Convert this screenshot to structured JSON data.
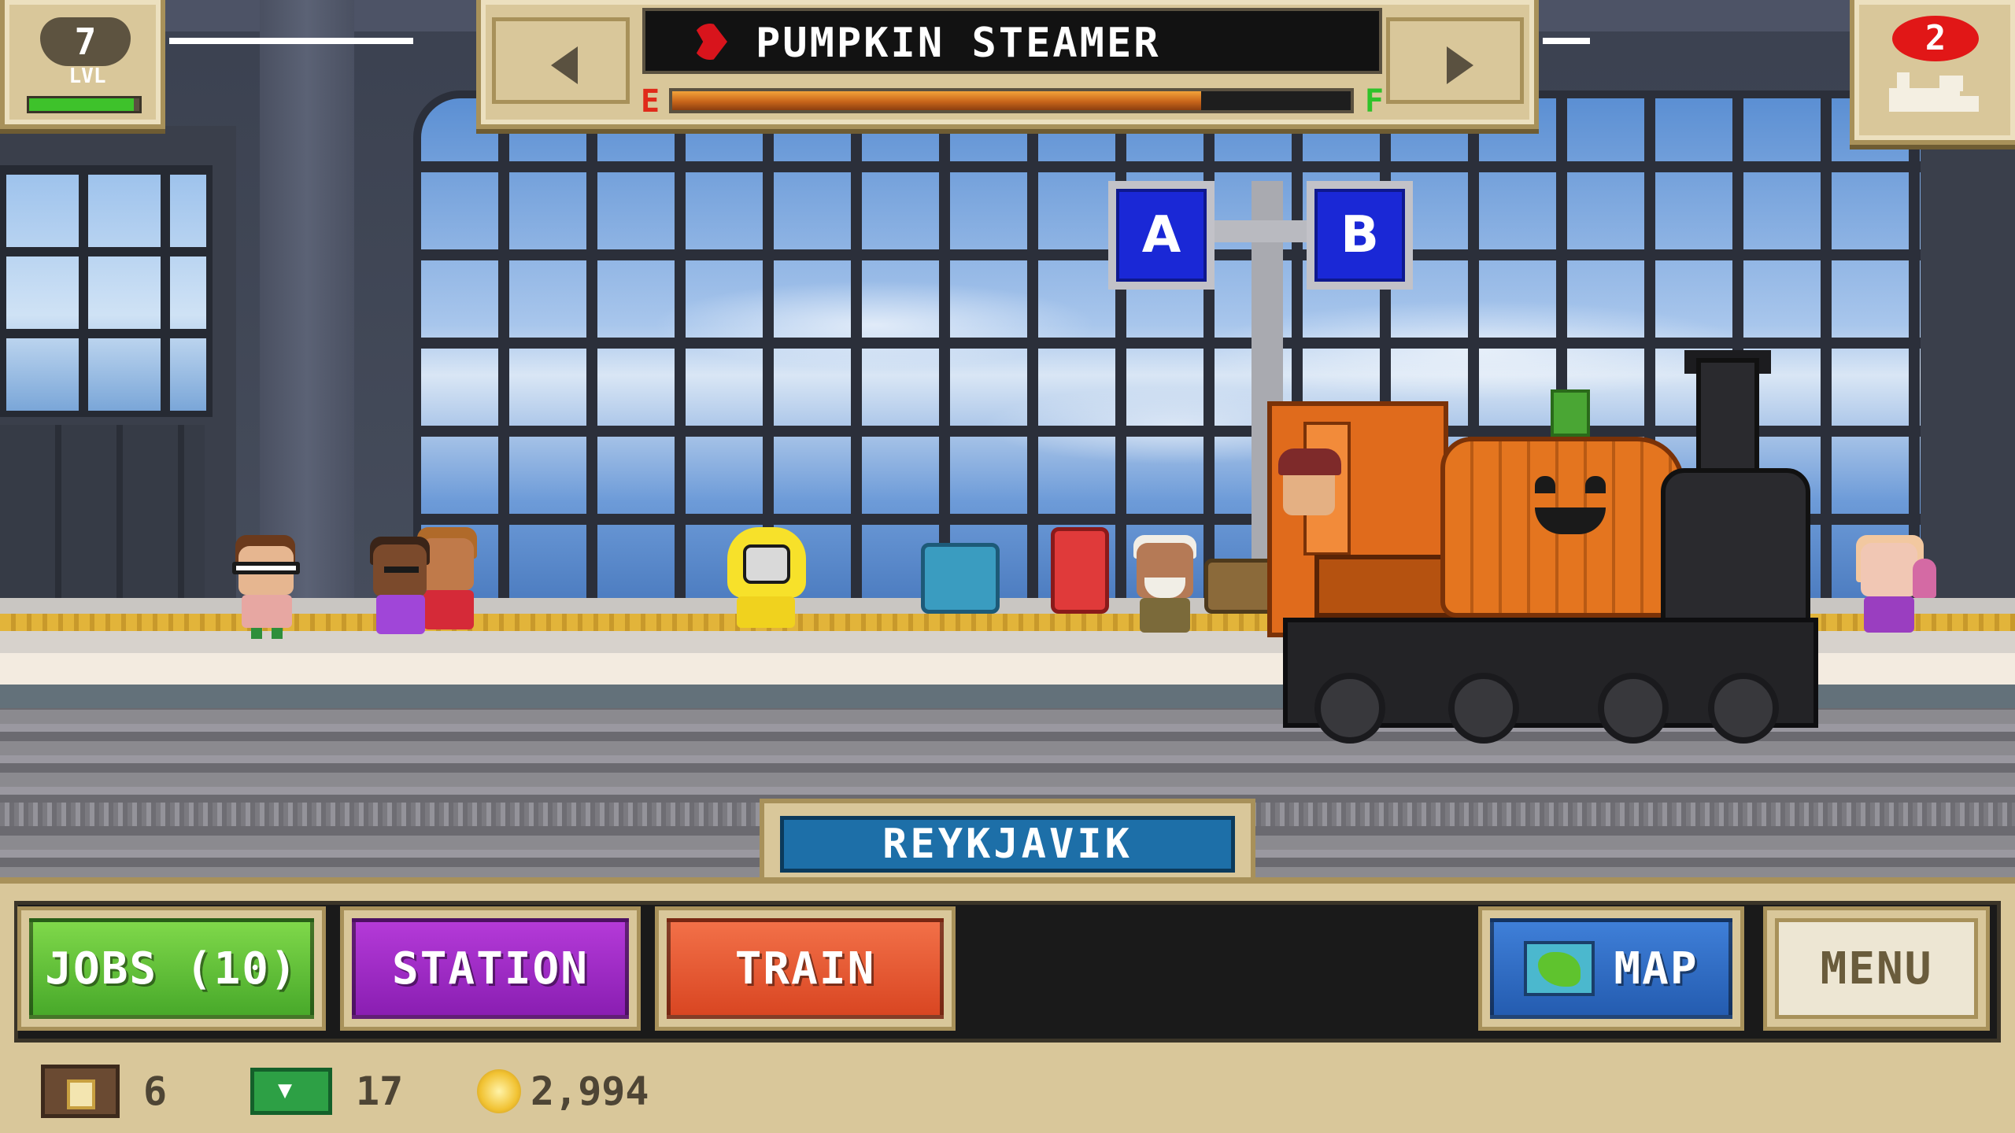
{
  "hud": {
    "level": "7",
    "level_label": "LVL",
    "level_progress_pct": 95,
    "tickets": "2"
  },
  "train_selector": {
    "train_name": "PUMPKIN STEAMER",
    "fuel_empty_label": "E",
    "fuel_full_label": "F",
    "fuel_level_pct": 78
  },
  "platform_signs": [
    "A",
    "B"
  ],
  "station": {
    "name": "REYKJAVIK"
  },
  "menu": {
    "jobs_label": "JOBS (10)",
    "station_label": "STATION",
    "train_label": "TRAIN",
    "map_label": "MAP",
    "menu_label": "MENU"
  },
  "resources": {
    "crates": "6",
    "cash": "17",
    "coins": "2,994"
  },
  "colors": {
    "jobs_button": "#48a92a",
    "station_button": "#8a1eb2",
    "train_button": "#d94622",
    "map_button": "#245cb0",
    "train_body": "#e4751f",
    "platform_sign": "#1a28d6"
  },
  "icons": {
    "train_icon": "red-train-icon",
    "ticket_engine": "locomotive-icon",
    "crate": "crate-icon",
    "cash": "cash-icon",
    "coin": "coin-icon",
    "map": "map-icon"
  }
}
